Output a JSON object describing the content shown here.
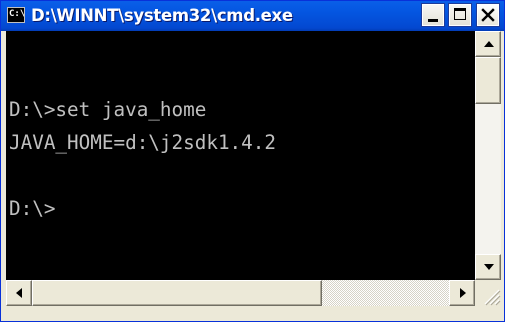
{
  "window": {
    "title": "D:\\WINNT\\system32\\cmd.exe",
    "icon": "cmd-prompt-icon",
    "icon_text": "C:\\",
    "controls": [
      "minimize-icon",
      "maximize-icon",
      "close-icon"
    ]
  },
  "console": {
    "lines": [
      "D:\\>set java_home",
      "JAVA_HOME=d:\\j2sdk1.4.2",
      "D:\\>"
    ],
    "text_color": "#c0c0c0",
    "background": "#000000"
  },
  "colors": {
    "titlebar": "#0455e0",
    "frame": "#ece9d8"
  }
}
